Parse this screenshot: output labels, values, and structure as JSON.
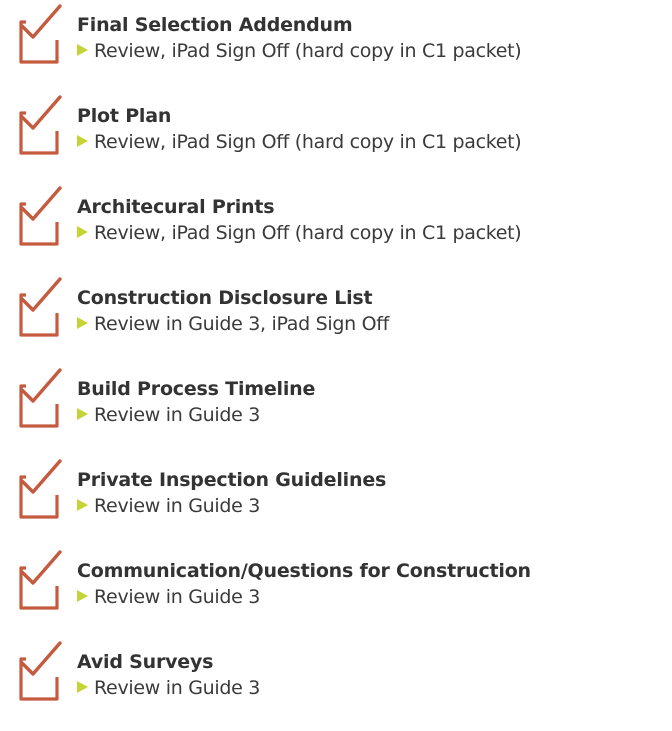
{
  "colors": {
    "checkbox": "#c45a3e",
    "arrow": "#c5d435",
    "text": "#333333"
  },
  "items": [
    {
      "title": "Final Selection Addendum",
      "note": "Review, iPad Sign Off (hard copy in C1 packet)",
      "icon": "check-box-icon",
      "arrow_icon": "triangle-right-icon"
    },
    {
      "title": "Plot Plan",
      "note": "Review, iPad Sign Off (hard copy in C1 packet)",
      "icon": "check-box-icon",
      "arrow_icon": "triangle-right-icon"
    },
    {
      "title": "Architecural Prints",
      "note": "Review, iPad Sign Off (hard copy in C1 packet)",
      "icon": "check-box-icon",
      "arrow_icon": "triangle-right-icon"
    },
    {
      "title": "Construction Disclosure List",
      "note": "Review in Guide 3, iPad Sign Off",
      "icon": "check-box-icon",
      "arrow_icon": "triangle-right-icon"
    },
    {
      "title": "Build Process Timeline",
      "note": "Review in Guide 3",
      "icon": "check-box-icon",
      "arrow_icon": "triangle-right-icon"
    },
    {
      "title": "Private Inspection Guidelines",
      "note": "Review in Guide 3",
      "icon": "check-box-icon",
      "arrow_icon": "triangle-right-icon"
    },
    {
      "title": "Communication/Questions for Construction",
      "note": "Review in Guide 3",
      "icon": "check-box-icon",
      "arrow_icon": "triangle-right-icon"
    },
    {
      "title": "Avid Surveys",
      "note": "Review in Guide 3",
      "icon": "check-box-icon",
      "arrow_icon": "triangle-right-icon"
    }
  ]
}
